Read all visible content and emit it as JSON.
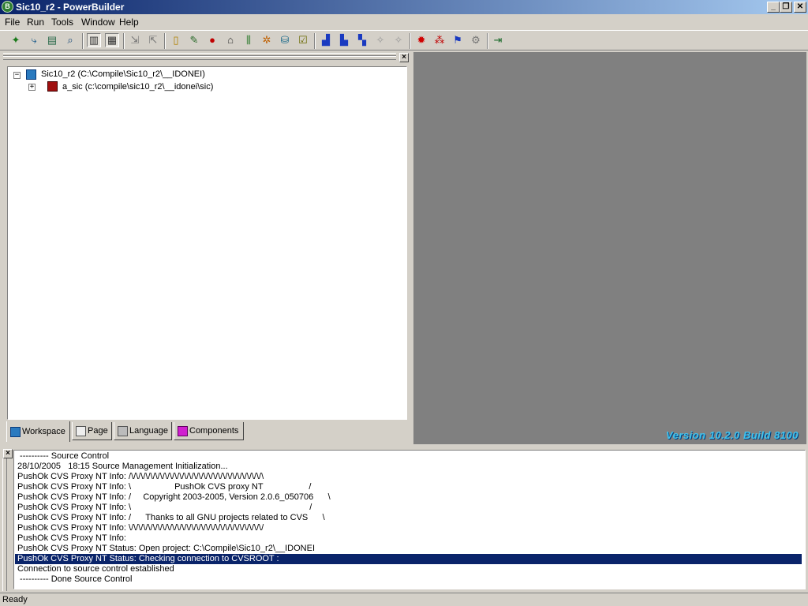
{
  "window": {
    "title": "Sic10_r2 - PowerBuilder",
    "app_icon": "powerbuilder-icon",
    "controls": {
      "minimize": "_",
      "restore": "❐",
      "close": "✕"
    }
  },
  "menu": {
    "items": [
      "File",
      "Run",
      "Tools",
      "Window",
      "Help"
    ]
  },
  "toolbar": {
    "buttons": [
      {
        "icon": "new-icon",
        "glyph": "✦"
      },
      {
        "icon": "inherit-icon",
        "glyph": "⤷"
      },
      {
        "icon": "open-icon",
        "glyph": "▤"
      },
      {
        "icon": "browser-icon",
        "glyph": "⌕"
      },
      {
        "icon": "system-tree-icon",
        "glyph": "▥"
      },
      {
        "icon": "output-view-icon",
        "glyph": "▦"
      },
      {
        "icon": "check-in-icon",
        "glyph": "⇲"
      },
      {
        "icon": "check-out-icon",
        "glyph": "⇱"
      },
      {
        "icon": "library-painter-icon",
        "glyph": "▯"
      },
      {
        "icon": "edit-source-icon",
        "glyph": "✎"
      },
      {
        "icon": "run-icon",
        "glyph": "●"
      },
      {
        "icon": "database-icon",
        "glyph": "⌂"
      },
      {
        "icon": "db-profile-icon",
        "glyph": "⫼"
      },
      {
        "icon": "debug-icon",
        "glyph": "✲"
      },
      {
        "icon": "deploy-icon",
        "glyph": "⛁"
      },
      {
        "icon": "todo-list-icon",
        "glyph": "☑"
      },
      {
        "icon": "build-workspace-icon",
        "glyph": "▟"
      },
      {
        "icon": "deploy-workspace-icon",
        "glyph": "▙"
      },
      {
        "icon": "incremental-build-icon",
        "glyph": "▚"
      },
      {
        "icon": "full-build-icon",
        "glyph": "✧"
      },
      {
        "icon": "skip-build-icon",
        "glyph": "✧"
      },
      {
        "icon": "stop-icon",
        "glyph": "✹"
      },
      {
        "icon": "select-debug-icon",
        "glyph": "⁂"
      },
      {
        "icon": "run-project-icon",
        "glyph": "⚑"
      },
      {
        "icon": "options-icon",
        "glyph": "⚙"
      },
      {
        "icon": "exit-icon",
        "glyph": "⇥"
      }
    ]
  },
  "workspace": {
    "tree": {
      "root": {
        "label": "Sic10_r2 (C:\\Compile\\Sic10_r2\\__IDONEI)",
        "expander": "−"
      },
      "children": [
        {
          "label": "a_sic (c:\\compile\\sic10_r2\\__idonei\\sic)",
          "expander": "+"
        }
      ]
    },
    "tabs": [
      {
        "label": "Workspace",
        "icon": "workspace-icon"
      },
      {
        "label": "Page",
        "icon": "page-icon"
      },
      {
        "label": "Language",
        "icon": "language-icon"
      },
      {
        "label": "Components",
        "icon": "components-icon"
      }
    ]
  },
  "mdi": {
    "version": "Version 10.2.0 Build 8100",
    "version_color": "#3ec3f0"
  },
  "output": {
    "lines": [
      " ---------- Source Control",
      "28/10/2005   18:15 Source Management Initialization...",
      "PushOk CVS Proxy NT Info: /\\/\\/\\/\\/\\/\\/\\/\\/\\/\\/\\/\\/\\/\\/\\/\\/\\/\\/\\/\\/\\/\\/\\/\\/\\/\\/\\/\\",
      "PushOk CVS Proxy NT Info: \\                  PushOk CVS proxy NT                   /",
      "PushOk CVS Proxy NT Info: /     Copyright 2003-2005, Version 2.0.6_050706      \\",
      "PushOk CVS Proxy NT Info: \\                                                                          /",
      "PushOk CVS Proxy NT Info: /      Thanks to all GNU projects related to CVS      \\",
      "PushOk CVS Proxy NT Info: \\/\\/\\/\\/\\/\\/\\/\\/\\/\\/\\/\\/\\/\\/\\/\\/\\/\\/\\/\\/\\/\\/\\/\\/\\/\\/\\/\\/",
      "PushOk CVS Proxy NT Info:",
      "PushOk CVS Proxy NT Status: Open project: C:\\Compile\\Sic10_r2\\__IDONEI",
      "PushOk CVS Proxy NT Status: Checking connection to CVSROOT :",
      "Connection to source control established",
      " ---------- Done Source Control"
    ],
    "selected_index": 10,
    "selection_color": "#0a246a"
  },
  "status": {
    "text": "Ready"
  }
}
